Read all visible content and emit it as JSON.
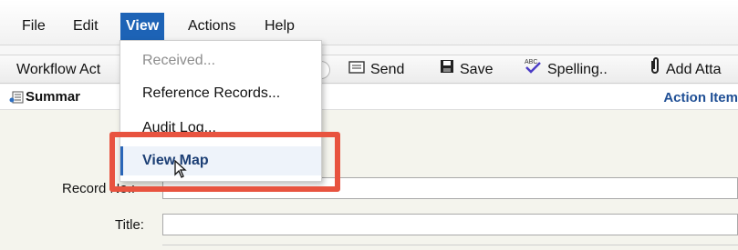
{
  "menubar": {
    "items": [
      "File",
      "Edit",
      "View",
      "Actions",
      "Help"
    ]
  },
  "toolbar": {
    "workflow_label": "Workflow Act",
    "send_label": "Send",
    "save_label": "Save",
    "spelling_label": "Spelling..",
    "add_attachment_label": "Add Atta"
  },
  "summary": {
    "title": "Summar",
    "action_items": "Action Item"
  },
  "form": {
    "record_no_label": "Record No.:",
    "title_label": "Title:"
  },
  "view_menu": {
    "items": [
      "Received...",
      "Reference Records...",
      "Audit Log...",
      "View Map"
    ]
  },
  "colors": {
    "menu_active_bg": "#1d63b6",
    "highlight_border": "#e8533f",
    "action_items_text": "#1f4f95"
  }
}
